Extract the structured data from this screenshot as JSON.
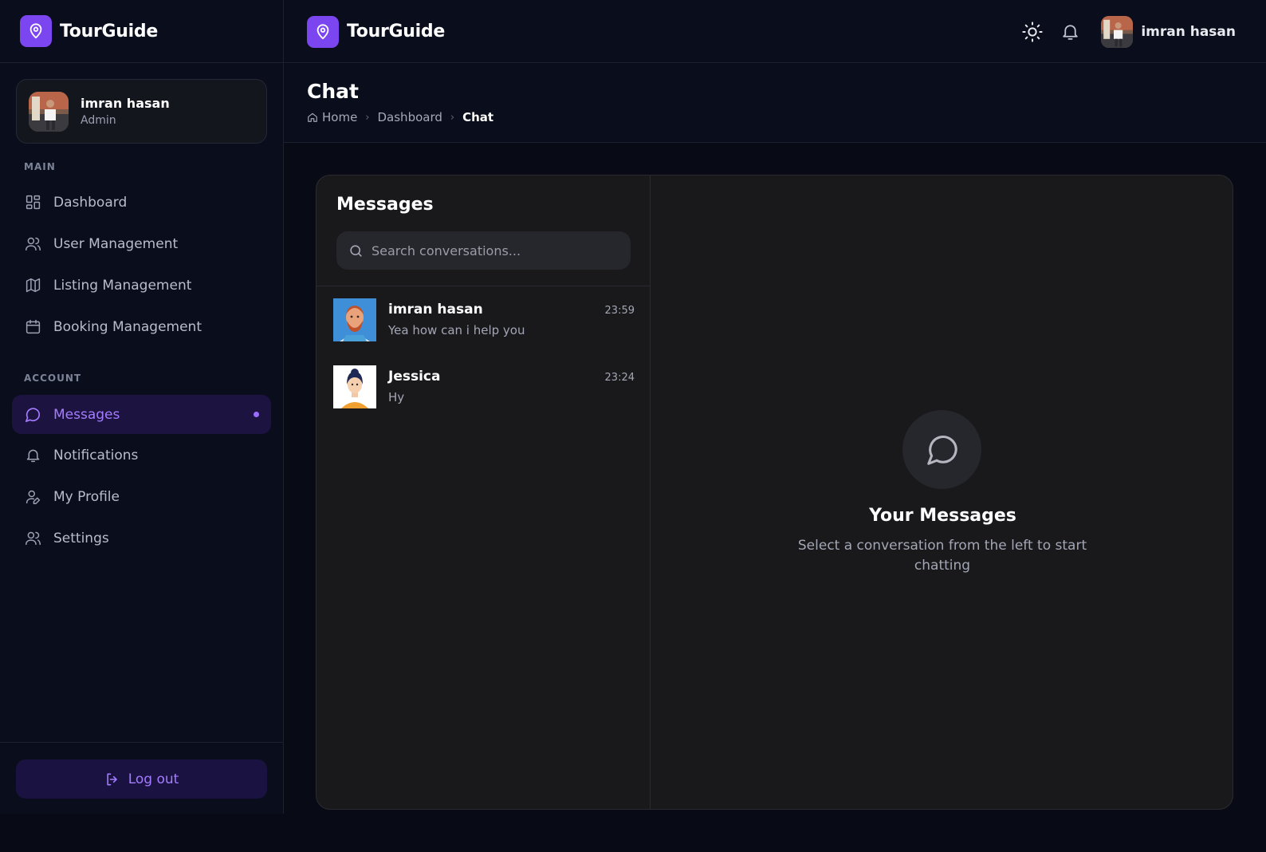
{
  "brand": {
    "name": "TourGuide",
    "icon": "map-pin-icon"
  },
  "user": {
    "name": "imran hasan",
    "role": "Admin"
  },
  "sidebar": {
    "main_label": "MAIN",
    "main_items": [
      {
        "label": "Dashboard",
        "icon": "grid-icon"
      },
      {
        "label": "User Management",
        "icon": "users-icon"
      },
      {
        "label": "Listing Management",
        "icon": "map-icon"
      },
      {
        "label": "Booking Management",
        "icon": "calendar-icon"
      }
    ],
    "account_label": "ACCOUNT",
    "account_items": [
      {
        "label": "Messages",
        "icon": "message-circle-icon",
        "active": true
      },
      {
        "label": "Notifications",
        "icon": "bell-icon"
      },
      {
        "label": "My Profile",
        "icon": "user-pen-icon"
      },
      {
        "label": "Settings",
        "icon": "users-icon"
      }
    ],
    "logout_label": "Log out"
  },
  "header": {
    "user_name": "imran hasan"
  },
  "page": {
    "title": "Chat",
    "breadcrumb": [
      "Home",
      "Dashboard",
      "Chat"
    ]
  },
  "chat": {
    "title": "Messages",
    "search_placeholder": "Search conversations...",
    "conversations": [
      {
        "name": "imran hasan",
        "last_message": "Yea how can i help you",
        "time": "23:59"
      },
      {
        "name": "Jessica",
        "last_message": "Hy",
        "time": "23:24"
      }
    ],
    "empty_title": "Your Messages",
    "empty_subtitle": "Select a conversation from the left to start chatting"
  },
  "colors": {
    "accent": "#7b45f0",
    "accent_text": "#a47cff",
    "background": "#080b16",
    "panel": "#19191c"
  }
}
